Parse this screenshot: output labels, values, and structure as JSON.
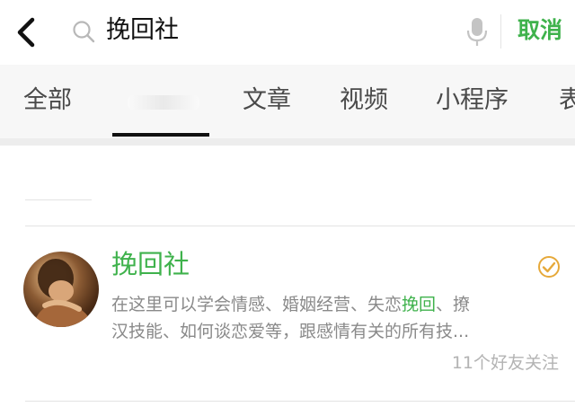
{
  "search": {
    "query": "挽回社",
    "cancel_label": "取消"
  },
  "tabs": [
    {
      "label": "全部"
    },
    {
      "label": "文章"
    },
    {
      "label": "视频"
    },
    {
      "label": "小程序"
    },
    {
      "label": "表"
    }
  ],
  "result": {
    "name": "挽回社",
    "desc_line1_pre": "在这里可以学会情感、婚姻经营、失恋",
    "desc_line1_hl": "挽回",
    "desc_line1_post": "、撩",
    "desc_line2": "汉技能、如何谈恋爱等，跟感情有关的所有技...",
    "friends": "11个好友关注"
  },
  "colors": {
    "accent": "#3fb24c",
    "verify": "#e6a93a"
  }
}
